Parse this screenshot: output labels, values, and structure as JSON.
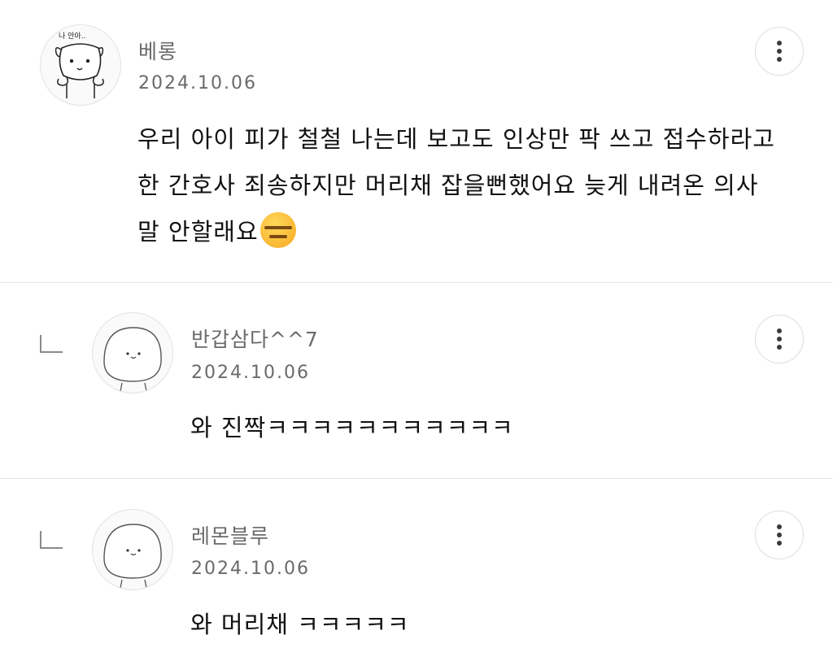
{
  "comments": [
    {
      "author": "베롱",
      "date": "2024.10.06",
      "lines": [
        "우리 아이 피가 철철 나는데 보고도 인상만 팍 쓰고 접수하라고",
        "한 간호사 죄송하지만 머리채 잡을뻔했어요 늦게 내려온 의사",
        "말 안할래요"
      ],
      "emoji": "expressionless-face",
      "avatar_text": "나 안아.."
    },
    {
      "author": "반갑삼다^^7",
      "date": "2024.10.06",
      "text": "와 진짝ㅋㅋㅋㅋㅋㅋㅋㅋㅋㅋㅋ"
    },
    {
      "author": "레몬블루",
      "date": "2024.10.06",
      "text": "와 머리채 ㅋㅋㅋㅋㅋ"
    }
  ],
  "icons": {
    "more": "more-vertical-icon",
    "reply": "reply-indent-icon"
  },
  "colors": {
    "meta_text": "#6a6a6a",
    "body_text": "#111111",
    "divider": "#e6e6e6",
    "emoji": "#f6a821"
  }
}
